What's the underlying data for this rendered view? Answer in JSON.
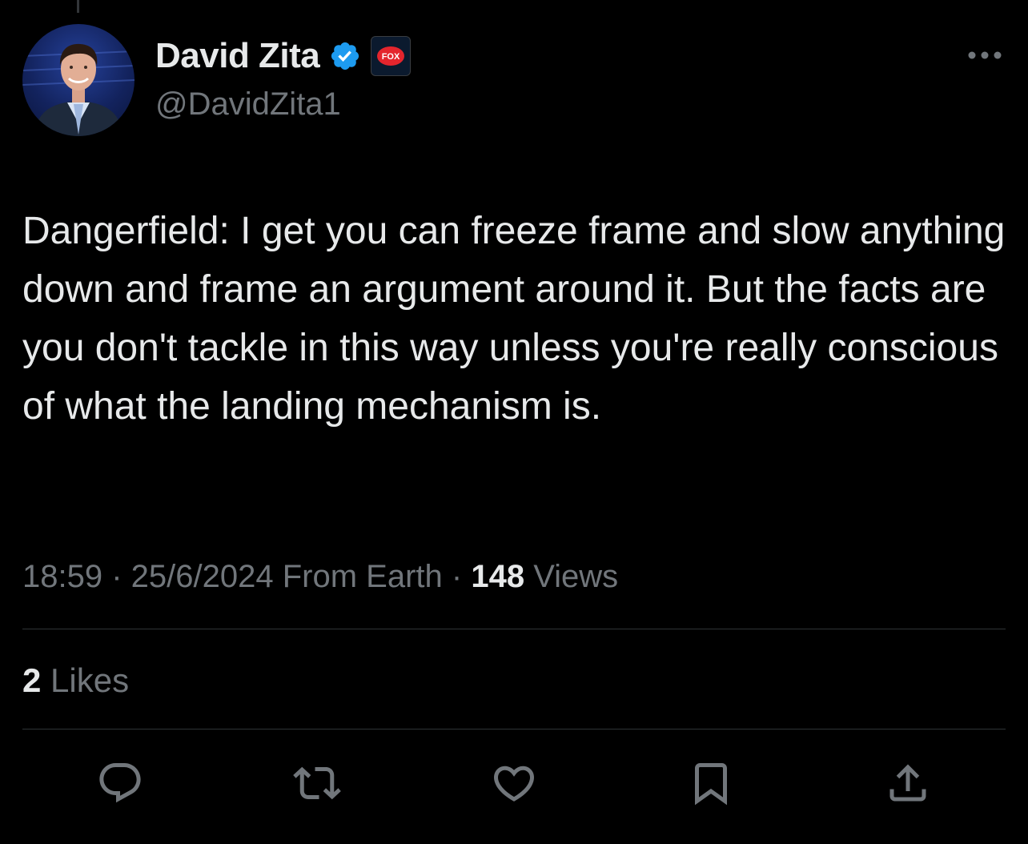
{
  "author": {
    "display_name": "David Zita",
    "handle": "@DavidZita1",
    "verified": true,
    "affiliate_badge_text": "FOX",
    "avatar_icon": "profile-photo"
  },
  "tweet": {
    "text": "Dangerfield: I get you can freeze frame and slow anything down and frame an argument around it. But the facts are you don't tackle in this way unless you're really conscious of what the landing mechanism is."
  },
  "meta": {
    "time": "18:59",
    "separator": " · ",
    "date": "25/6/2024",
    "source": "From Earth",
    "views_count": "148",
    "views_label": "Views"
  },
  "stats": {
    "likes_count": "2",
    "likes_label": "Likes"
  },
  "actions": [
    {
      "icon": "reply-icon"
    },
    {
      "icon": "retweet-icon"
    },
    {
      "icon": "like-icon"
    },
    {
      "icon": "bookmark-icon"
    },
    {
      "icon": "share-icon"
    }
  ],
  "colors": {
    "background": "#000000",
    "primary_text": "#e7e9ea",
    "secondary_text": "#71767b",
    "divider": "#2f3336",
    "verified_blue": "#1d9bf0",
    "fox_red": "#e4252d"
  }
}
